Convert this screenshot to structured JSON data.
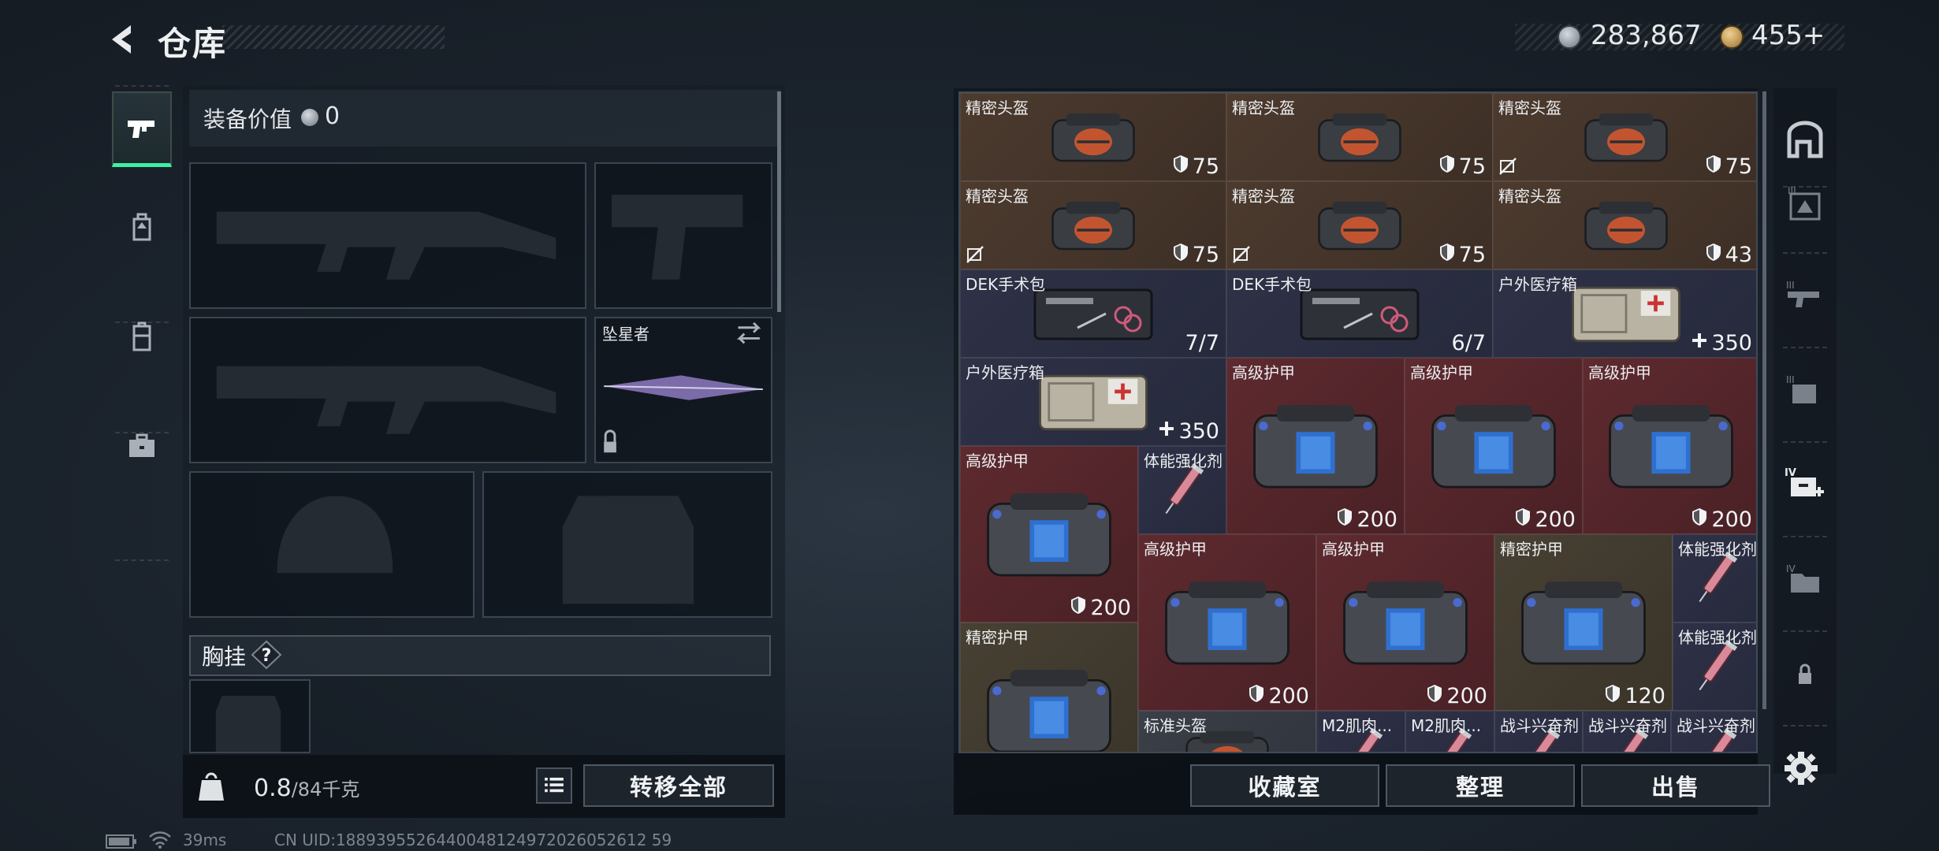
{
  "header": {
    "title": "仓库"
  },
  "currencies": [
    {
      "value": "283,867",
      "icon": "silver-coin-icon"
    },
    {
      "value": "455+",
      "icon": "gold-coin-icon"
    }
  ],
  "left_nav": [
    "pistol-icon",
    "backpack-icon",
    "vest-icon",
    "toolbox-icon"
  ],
  "equipment": {
    "value_label": "装备价值",
    "value": "0",
    "melee_name": "坠星者",
    "chest_rig_label": "胸挂",
    "help": "?",
    "weight_value": "0.8",
    "weight_max": "/84千克",
    "transfer_all": "转移全部"
  },
  "stash": {
    "items": [
      {
        "name": "精密头盔",
        "count": "75",
        "bg": "brown"
      },
      {
        "name": "精密头盔",
        "count": "75",
        "bg": "brown"
      },
      {
        "name": "精密头盔",
        "count": "75",
        "bg": "brown"
      },
      {
        "name": "精密头盔",
        "count": "75",
        "bg": "brown"
      },
      {
        "name": "精密头盔",
        "count": "75",
        "bg": "brown"
      },
      {
        "name": "精密头盔",
        "count": "43",
        "bg": "brown"
      },
      {
        "name": "DEK手术包",
        "count": "7/7",
        "bg": "navy"
      },
      {
        "name": "DEK手术包",
        "count": "6/7",
        "bg": "navy"
      },
      {
        "name": "户外医疗箱",
        "count": "350",
        "bg": "navy"
      },
      {
        "name": "户外医疗箱",
        "count": "350",
        "bg": "navy"
      },
      {
        "name": "高级护甲",
        "count": "200",
        "bg": "red"
      },
      {
        "name": "高级护甲",
        "count": "200",
        "bg": "red"
      },
      {
        "name": "高级护甲",
        "count": "200",
        "bg": "red"
      },
      {
        "name": "高级护甲",
        "count": "200",
        "bg": "red"
      },
      {
        "name": "体能强化剂",
        "count": "",
        "bg": "navy"
      },
      {
        "name": "高级护甲",
        "count": "200",
        "bg": "red"
      },
      {
        "name": "高级护甲",
        "count": "200",
        "bg": "red"
      },
      {
        "name": "精密护甲",
        "count": "120",
        "bg": "olive"
      },
      {
        "name": "体能强化剂",
        "count": "",
        "bg": "navy"
      },
      {
        "name": "体能强化剂",
        "count": "",
        "bg": "navy"
      },
      {
        "name": "精密护甲",
        "count": "",
        "bg": "olive"
      },
      {
        "name": "标准头盔",
        "count": "",
        "bg": "grey"
      },
      {
        "name": "M2肌肉...",
        "count": "",
        "bg": "navy"
      },
      {
        "name": "M2肌肉...",
        "count": "",
        "bg": "navy"
      },
      {
        "name": "战斗兴奋剂",
        "count": "",
        "bg": "navy"
      },
      {
        "name": "战斗兴奋剂",
        "count": "",
        "bg": "navy"
      },
      {
        "name": "战斗兴奋剂",
        "count": "",
        "bg": "navy"
      }
    ]
  },
  "actions": {
    "collection": "收藏室",
    "organize": "整理",
    "sell": "出售"
  },
  "filters": [
    "all-items-icon",
    "helmet-filter-icon",
    "weapon-filter-icon",
    "gear-filter-icon",
    "medical-filter-icon",
    "folder-filter-icon",
    "lock-icon"
  ],
  "status": {
    "ping": "39ms",
    "uid": "CN UID:1889395526440048124972026052612 59"
  }
}
